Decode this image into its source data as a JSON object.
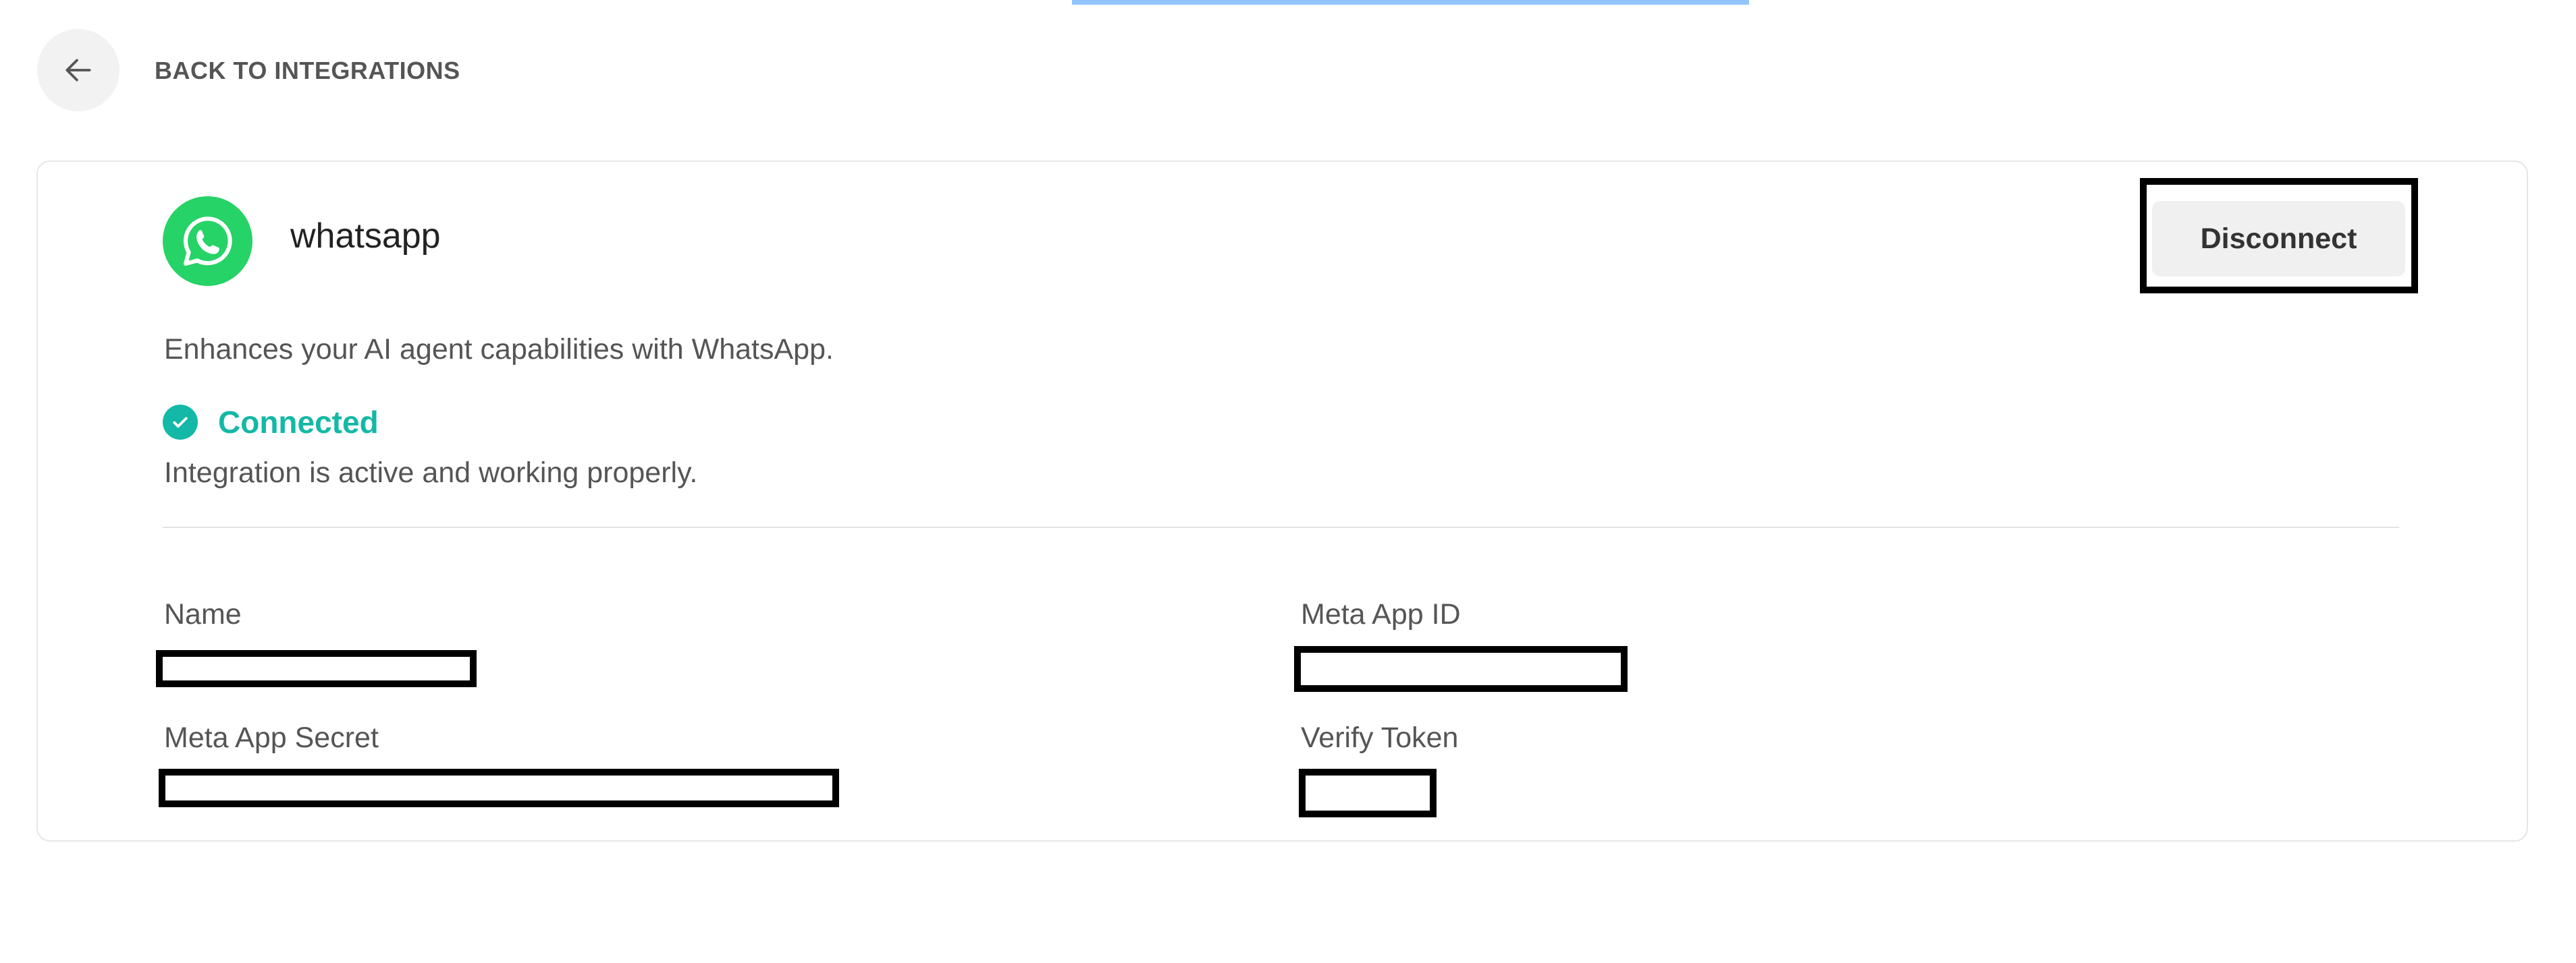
{
  "nav": {
    "back_label": "BACK TO INTEGRATIONS",
    "back_icon": "arrow-left-icon"
  },
  "integration": {
    "name": "whatsapp",
    "logo_icon": "whatsapp-logo-icon",
    "brand_color": "#25D366",
    "description": "Enhances your AI agent capabilities with WhatsApp.",
    "disconnect_label": "Disconnect"
  },
  "status": {
    "icon": "check-circle-icon",
    "label": "Connected",
    "color": "#14B8A6",
    "message": "Integration is active and working properly."
  },
  "fields": {
    "name_label": "Name",
    "meta_app_id_label": "Meta App ID",
    "meta_app_secret_label": "Meta App Secret",
    "verify_token_label": "Verify Token"
  },
  "colors": {
    "accent_bar": "#93C5FD",
    "text_muted": "#555555"
  }
}
